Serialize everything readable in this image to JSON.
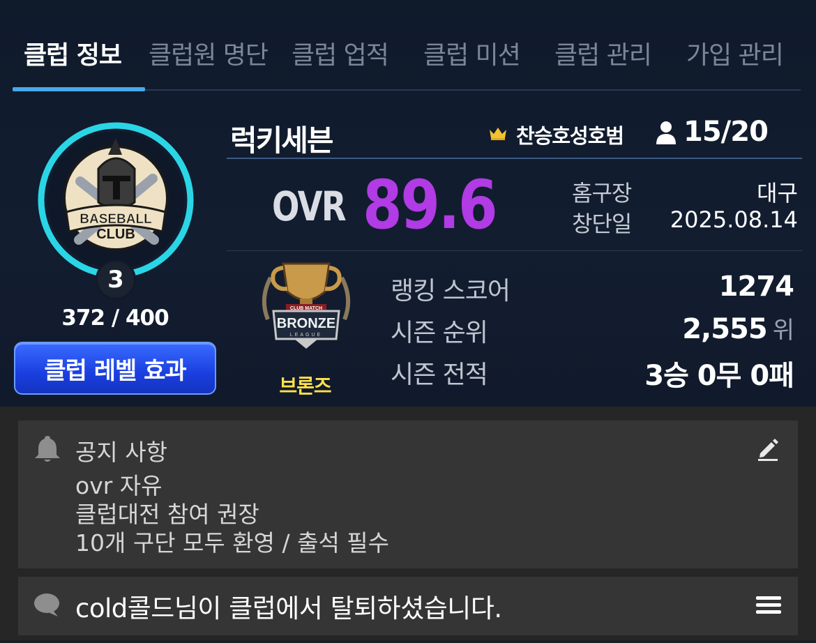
{
  "tabs": [
    {
      "label": "클럽 정보",
      "active": true
    },
    {
      "label": "클럽원 명단",
      "active": false
    },
    {
      "label": "클럽 업적",
      "active": false
    },
    {
      "label": "클럽 미션",
      "active": false
    },
    {
      "label": "클럽 관리",
      "active": false
    },
    {
      "label": "가입 관리",
      "active": false
    }
  ],
  "emblem": {
    "text_line1": "BASEBALL",
    "text_line2": "CLUB",
    "level": "3",
    "exp": "372 / 400",
    "exp_progress": 0.93,
    "ring_color": "#2ad6e6"
  },
  "level_effect_button": "클럽 레벨 효과",
  "club": {
    "name": "럭키세븐",
    "leader": "찬승호성호범",
    "members": "15/20"
  },
  "ovr": {
    "label": "OVR",
    "value": "89.6",
    "color": "#b13be4"
  },
  "info": {
    "home_label": "홈구장",
    "home_value": "대구",
    "founded_label": "창단일",
    "founded_value": "2025.08.14"
  },
  "league": {
    "badge_top": "CLUB MATCH",
    "badge_text": "BRONZE",
    "badge_sub": "LEAGUE",
    "name": "브론즈"
  },
  "stats": {
    "ranking_label": "랭킹 스코어",
    "ranking_value": "1274",
    "season_rank_label": "시즌 순위",
    "season_rank_value": "2,555",
    "season_rank_unit": "위",
    "season_record_label": "시즌 전적",
    "season_record_value": "3승 0무 0패"
  },
  "notice": {
    "title": "공지 사항",
    "lines": [
      "ovr 자유",
      "클럽대전 참여 권장",
      "10개 구단 모두 환영 / 출석 필수"
    ]
  },
  "chat": {
    "text": "cold콜드님이 클럽에서 탈퇴하셨습니다."
  },
  "icons": {
    "crown": "crown-icon",
    "member": "person-icon",
    "notice": "bell-icon",
    "edit": "pencil-icon",
    "chat": "chat-bubble-icon",
    "menu": "hamburger-icon"
  }
}
